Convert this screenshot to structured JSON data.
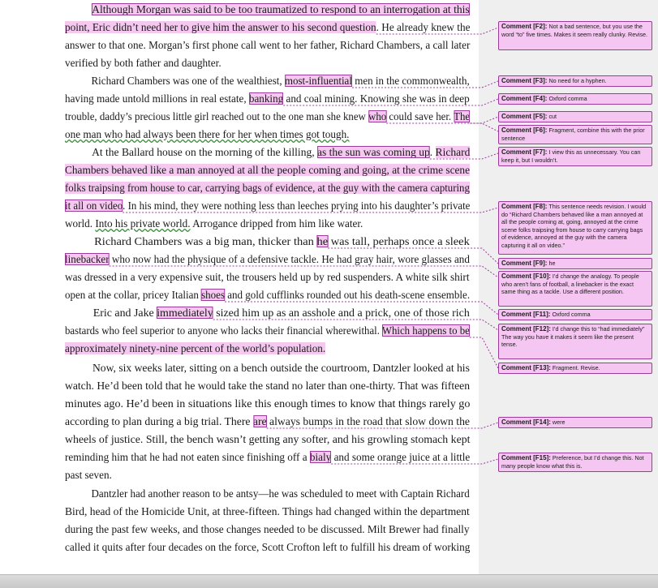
{
  "document": {
    "lines": [
      [
        {
          "t": "          "
        },
        {
          "t": "Although Morgan was said to be too traumatized to respond to an interrogation at this",
          "c": "hb"
        }
      ],
      [
        {
          "t": "point, Eric didn’t need her to give him the answer to his second question",
          "c": "hl"
        },
        {
          "t": ". He already knew the"
        }
      ],
      [
        {
          "t": "answer to that one. Morgan’s first phone call went to her father, Richard Chambers, a call later"
        }
      ],
      [
        {
          "t": "verified by both father and daughter."
        }
      ],
      [
        {
          "t": "          Richard Chambers was one of the wealthiest, "
        },
        {
          "t": "most-influential",
          "c": "hb"
        },
        {
          "t": " men in the commonwealth,"
        }
      ],
      [
        {
          "t": "having made untold millions in real estate, "
        },
        {
          "t": "banking",
          "c": "hb"
        },
        {
          "t": " and coal mining. Knowing she was in deep"
        }
      ],
      [
        {
          "t": "trouble, daddy’s precious little girl reached out to the one man she knew "
        },
        {
          "t": "who",
          "c": "hb"
        },
        {
          "t": " could save her. "
        },
        {
          "t": "The",
          "c": "hb"
        }
      ],
      [
        {
          "t": "one man who had always been there for her when times got tough.",
          "c": "gm"
        }
      ],
      [
        {
          "t": "          At the Ballard house on the morning of the killing, "
        },
        {
          "t": "as the sun was coming up",
          "c": "hb"
        },
        {
          "t": ". "
        },
        {
          "t": "Richard",
          "c": "hl"
        }
      ],
      [
        {
          "t": "Chambers behaved like a man annoyed at all the people coming and going, at the crime scene",
          "c": "hl"
        }
      ],
      [
        {
          "t": "folks traipsing from house to car, carrying bags of evidence, at the guy with the camera capturing",
          "c": "hl"
        }
      ],
      [
        {
          "t": "it all on video",
          "c": "hb"
        },
        {
          "t": ". In his mind, they were nothing less than leeches prying into his daughter’s private"
        }
      ],
      [
        {
          "t": "world. "
        },
        {
          "t": "Into his private world.",
          "c": "gm"
        },
        {
          "t": " Arrogance dripped from him like water."
        }
      ],
      [
        {
          "t": "          Richard Chambers was a big man, thicker than "
        },
        {
          "t": "he",
          "c": "hb"
        },
        {
          "t": " was tall, perhaps once a sleek"
        }
      ],
      [
        {
          "t": "linebacker",
          "c": "hb"
        },
        {
          "t": " who now had the physique of a defensive tackle. He had gray hair, wore glasses and"
        }
      ],
      [
        {
          "t": "was dressed in a very expensive suit, the trousers held up by red suspenders. A white silk shirt"
        }
      ],
      [
        {
          "t": "open at the collar, pricey Italian "
        },
        {
          "t": "shoes",
          "c": "hb"
        },
        {
          "t": " and gold cufflinks rounded out his death-scene ensemble."
        }
      ],
      [
        {
          "t": "          Eric and Jake "
        },
        {
          "t": "immediately",
          "c": "hb"
        },
        {
          "t": " sized him up as an asshole and a prick, one of those rich"
        }
      ],
      [
        {
          "t": "bastards who feel superior to anyone who lacks their financial wherewithal. "
        },
        {
          "t": "Which happens to be",
          "c": "hb"
        }
      ],
      [
        {
          "t": "approximately ninety-nine percent of the world’s population.",
          "c": "hl"
        }
      ],
      [
        {
          "t": "          Now, six weeks later, sitting on a bench outside the courtroom, Dantzler looked at his"
        }
      ],
      [
        {
          "t": "watch. He’d been told that he would take the stand no later than one-thirty. That was fifteen"
        }
      ],
      [
        {
          "t": "minutes ago. He’d been in situations like this enough times to know that things rarely go"
        }
      ],
      [
        {
          "t": "according to plan during a big trial. There "
        },
        {
          "t": "are",
          "c": "hb"
        },
        {
          "t": " always bumps in the road that slow down the"
        }
      ],
      [
        {
          "t": "wheels of justice. Still, the bench wasn’t getting any softer, and his growling stomach kept"
        }
      ],
      [
        {
          "t": "reminding him that he had not eaten since finishing off a "
        },
        {
          "t": "bialy",
          "c": "hb"
        },
        {
          "t": " and some orange juice at a little"
        }
      ],
      [
        {
          "t": "past seven."
        }
      ],
      [
        {
          "t": "          Dantzler had another reason to be antsy—he was scheduled to meet with Captain Richard"
        }
      ],
      [
        {
          "t": "Bird, head of the Homicide Unit, at three-fifteen. Things had changed within the department"
        }
      ],
      [
        {
          "t": "during the past few weeks, and those changes needed to be discussed. Milt Brewer had finally"
        }
      ],
      [
        {
          "t": "called it quits after four decades on the force, Scott Crofton left to fulfill his dream of working"
        }
      ]
    ]
  },
  "comments": [
    {
      "tag": "Comment [F2]:",
      "text": "Not a bad sentence, but you use the word “to” five times. Makes it seem really clunky.  Revise."
    },
    {
      "tag": "Comment [F3]:",
      "text": "No need for a hyphen."
    },
    {
      "tag": "Comment [F4]:",
      "text": "Oxford comma"
    },
    {
      "tag": "Comment [F5]:",
      "text": "cut"
    },
    {
      "tag": "Comment [F6]:",
      "text": "Fragment, combine this with the prior sentence"
    },
    {
      "tag": "Comment [F7]:",
      "text": "I view this as unnecessary. You can keep it, but I wouldn’t."
    },
    {
      "tag": "Comment [F8]:",
      "text": "This sentence needs revision.  I would do “Richard Chambers behaved like a man annoyed at all the people coming at, going, annoyed at the crime scene folks traipsing from house to carry carrying bags of evidence, annoyed at the guy with the camera capturing it all on video.”"
    },
    {
      "tag": "Comment [F9]:",
      "text": "he"
    },
    {
      "tag": "Comment [F10]:",
      "text": "I’d change the analogy. To people who aren’t fans of football, a linebacker is the exact same thing as a tackle.  Use a different position."
    },
    {
      "tag": "Comment [F11]:",
      "text": "Oxford comma"
    },
    {
      "tag": "Comment [F12]:",
      "text": "I’d change this to “had immediately”\nThe way you have it makes it seem like the present tense."
    },
    {
      "tag": "Comment [F13]:",
      "text": "Fragment.  Revise."
    },
    {
      "tag": "Comment [F14]:",
      "text": "were"
    },
    {
      "tag": "Comment [F15]:",
      "text": "Preference, but I’d change this. Not many people know what this is."
    }
  ],
  "colors": {
    "highlight": "#f5c8f0",
    "comment_border": "#9b3c9b",
    "comment_fill": "#f6c6f2",
    "grammar_underline": "#3c8d3c"
  }
}
